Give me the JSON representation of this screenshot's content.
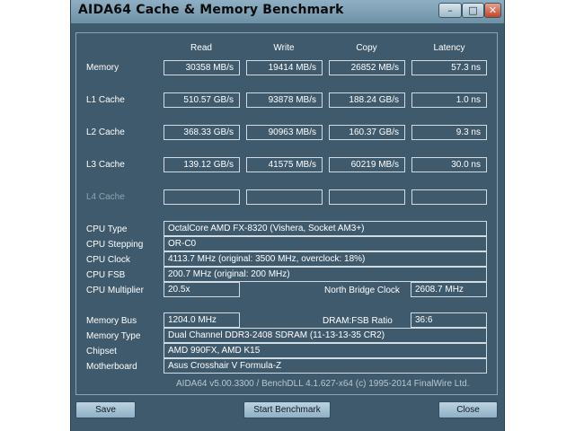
{
  "window": {
    "title": "AIDA64 Cache & Memory Benchmark",
    "minimize_glyph": "–",
    "maximize_glyph": "□",
    "close_glyph": "✕"
  },
  "columns": [
    "Read",
    "Write",
    "Copy",
    "Latency"
  ],
  "rows": [
    {
      "label": "Memory",
      "values": [
        "30358 MB/s",
        "19414 MB/s",
        "26852 MB/s",
        "57.3 ns"
      ]
    },
    {
      "label": "L1 Cache",
      "values": [
        "510.57 GB/s",
        "93878 MB/s",
        "188.24 GB/s",
        "1.0 ns"
      ]
    },
    {
      "label": "L2 Cache",
      "values": [
        "368.33 GB/s",
        "90963 MB/s",
        "160.37 GB/s",
        "9.3 ns"
      ]
    },
    {
      "label": "L3 Cache",
      "values": [
        "139.12 GB/s",
        "41575 MB/s",
        "60219 MB/s",
        "30.0 ns"
      ]
    },
    {
      "label": "L4 Cache",
      "values": [
        "",
        "",
        "",
        ""
      ]
    }
  ],
  "info": {
    "cpu_type_label": "CPU Type",
    "cpu_type": "OctalCore AMD FX-8320  (Vishera, Socket AM3+)",
    "cpu_stepping_label": "CPU Stepping",
    "cpu_stepping": "OR-C0",
    "cpu_clock_label": "CPU Clock",
    "cpu_clock": "4113.7 MHz  (original: 3500 MHz, overclock: 18%)",
    "cpu_fsb_label": "CPU FSB",
    "cpu_fsb": "200.7 MHz  (original: 200 MHz)",
    "cpu_multiplier_label": "CPU Multiplier",
    "cpu_multiplier": "20.5x",
    "north_bridge_label": "North Bridge Clock",
    "north_bridge": "2608.7 MHz",
    "memory_bus_label": "Memory Bus",
    "memory_bus": "1204.0 MHz",
    "dram_fsb_label": "DRAM:FSB Ratio",
    "dram_fsb": "36:6",
    "memory_type_label": "Memory Type",
    "memory_type": "Dual Channel DDR3-2408 SDRAM  (11-13-13-35 CR2)",
    "chipset_label": "Chipset",
    "chipset": "AMD 990FX, AMD K15",
    "motherboard_label": "Motherboard",
    "motherboard": "Asus Crosshair V Formula-Z"
  },
  "footer": "AIDA64 v5.00.3300 / BenchDLL 4.1.627-x64  (c) 1995-2014 FinalWire Ltd.",
  "buttons": {
    "save": "Save",
    "start": "Start Benchmark",
    "close": "Close"
  }
}
